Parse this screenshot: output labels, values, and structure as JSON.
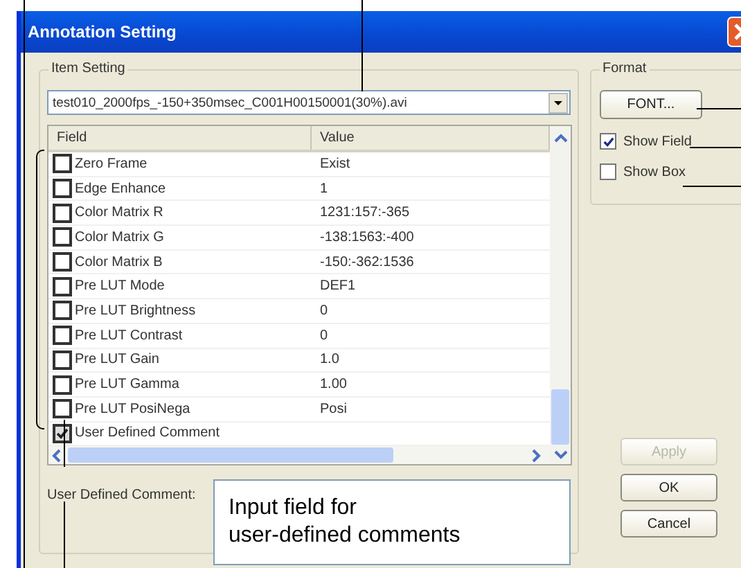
{
  "window": {
    "title": "Annotation Setting"
  },
  "item_setting": {
    "label": "Item Setting",
    "file": "test010_2000fps_-150+350msec_C001H00150001(30%).avi",
    "columns": [
      "Field",
      "Value"
    ],
    "rows": [
      {
        "field": "Zero Frame",
        "value": "Exist",
        "checked": false
      },
      {
        "field": "Edge Enhance",
        "value": "1",
        "checked": false
      },
      {
        "field": "Color Matrix R",
        "value": "1231:157:-365",
        "checked": false
      },
      {
        "field": "Color Matrix G",
        "value": "-138:1563:-400",
        "checked": false
      },
      {
        "field": "Color Matrix B",
        "value": "-150:-362:1536",
        "checked": false
      },
      {
        "field": "Pre LUT Mode",
        "value": "DEF1",
        "checked": false
      },
      {
        "field": "Pre LUT Brightness",
        "value": "0",
        "checked": false
      },
      {
        "field": "Pre LUT Contrast",
        "value": "0",
        "checked": false
      },
      {
        "field": "Pre LUT Gain",
        "value": "1.0",
        "checked": false
      },
      {
        "field": "Pre LUT Gamma",
        "value": "1.00",
        "checked": false
      },
      {
        "field": "Pre LUT PosiNega",
        "value": "Posi",
        "checked": false
      },
      {
        "field": "User Defined Comment",
        "checked": true
      }
    ],
    "comment": {
      "label": "User Defined Comment:",
      "value": "Input field for\nuser-defined comments"
    }
  },
  "format": {
    "label": "Format",
    "font_button": "FONT...",
    "options": [
      {
        "label": "Show Field",
        "checked": true
      },
      {
        "label": "Show Box",
        "checked": false
      }
    ]
  },
  "buttons": [
    {
      "label": "Apply",
      "disabled": true
    },
    {
      "label": "OK",
      "disabled": false
    },
    {
      "label": "Cancel",
      "disabled": false
    }
  ]
}
